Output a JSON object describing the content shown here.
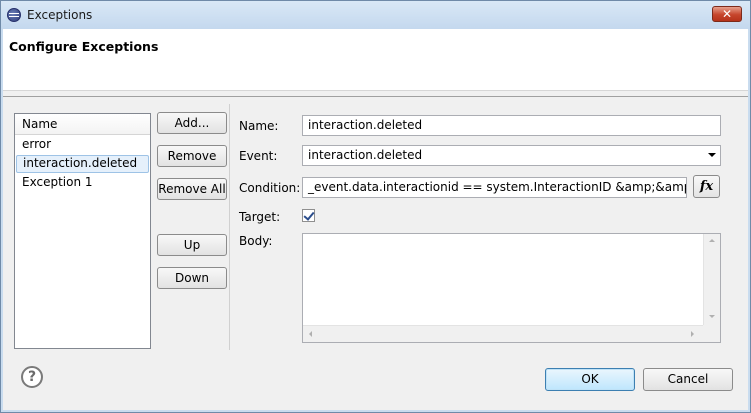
{
  "window": {
    "title": "Exceptions",
    "close_glyph": "✕",
    "app_icon": "eclipse-icon"
  },
  "header": {
    "title": "Configure Exceptions"
  },
  "exception_list": {
    "column_header": "Name",
    "items": [
      "error",
      "interaction.deleted",
      "Exception 1"
    ],
    "selected_index": 1
  },
  "list_buttons": {
    "add": "Add...",
    "remove": "Remove",
    "remove_all": "Remove All",
    "up": "Up",
    "down": "Down"
  },
  "form": {
    "name_label": "Name:",
    "name_value": "interaction.deleted",
    "event_label": "Event:",
    "event_value": "interaction.deleted",
    "condition_label": "Condition:",
    "condition_value": "_event.data.interactionid == system.InteractionID &amp;&amp; (!_event",
    "fx_label": "fx",
    "target_label": "Target:",
    "target_checked": true,
    "body_label": "Body:",
    "body_value": ""
  },
  "footer": {
    "help_glyph": "?",
    "ok": "OK",
    "cancel": "Cancel"
  }
}
